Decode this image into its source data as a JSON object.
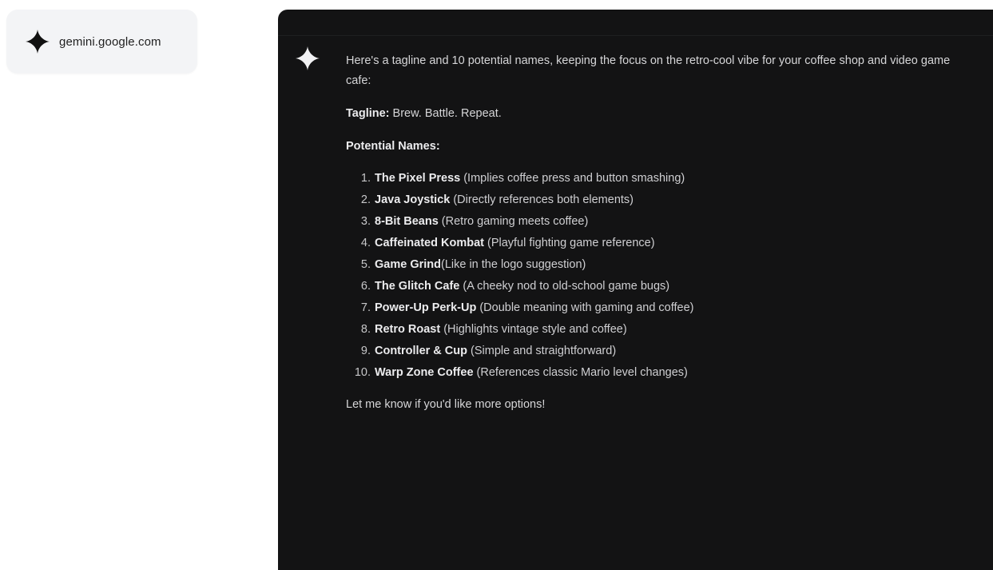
{
  "source": {
    "domain": "gemini.google.com",
    "icon": "gemini-sparkle-icon"
  },
  "response": {
    "icon": "gemini-sparkle-icon",
    "intro": "Here's a tagline and 10 potential names, keeping the focus on the retro-cool vibe for your coffee shop and video game cafe:",
    "tagline_label": "Tagline:",
    "tagline_value": " Brew. Battle. Repeat.",
    "names_heading": "Potential Names:",
    "names": [
      {
        "num": "1.",
        "title": "The Pixel Press",
        "desc": " (Implies coffee press and button smashing)"
      },
      {
        "num": "2.",
        "title": "Java Joystick",
        "desc": " (Directly references both elements)"
      },
      {
        "num": "3.",
        "title": "8-Bit Beans",
        "desc": " (Retro gaming meets coffee)"
      },
      {
        "num": "4.",
        "title": "Caffeinated Kombat",
        "desc": " (Playful fighting game reference)"
      },
      {
        "num": "5.",
        "title": "Game Grind",
        "desc": "(Like in the logo suggestion)"
      },
      {
        "num": "6.",
        "title": "The Glitch Cafe",
        "desc": " (A cheeky nod to old-school game bugs)"
      },
      {
        "num": "7.",
        "title": "Power-Up Perk-Up",
        "desc": " (Double meaning with gaming and coffee)"
      },
      {
        "num": "8.",
        "title": "Retro Roast",
        "desc": " (Highlights vintage style and coffee)"
      },
      {
        "num": "9.",
        "title": "Controller & Cup",
        "desc": " (Simple and straightforward)"
      },
      {
        "num": "10.",
        "title": "Warp Zone Coffee",
        "desc": " (References classic Mario level changes)"
      }
    ],
    "outro": "Let me know if you'd like more options!"
  },
  "colors": {
    "panel_bg": "#131314",
    "text": "#d6d6d8",
    "chip_bg": "#f3f4f6"
  }
}
